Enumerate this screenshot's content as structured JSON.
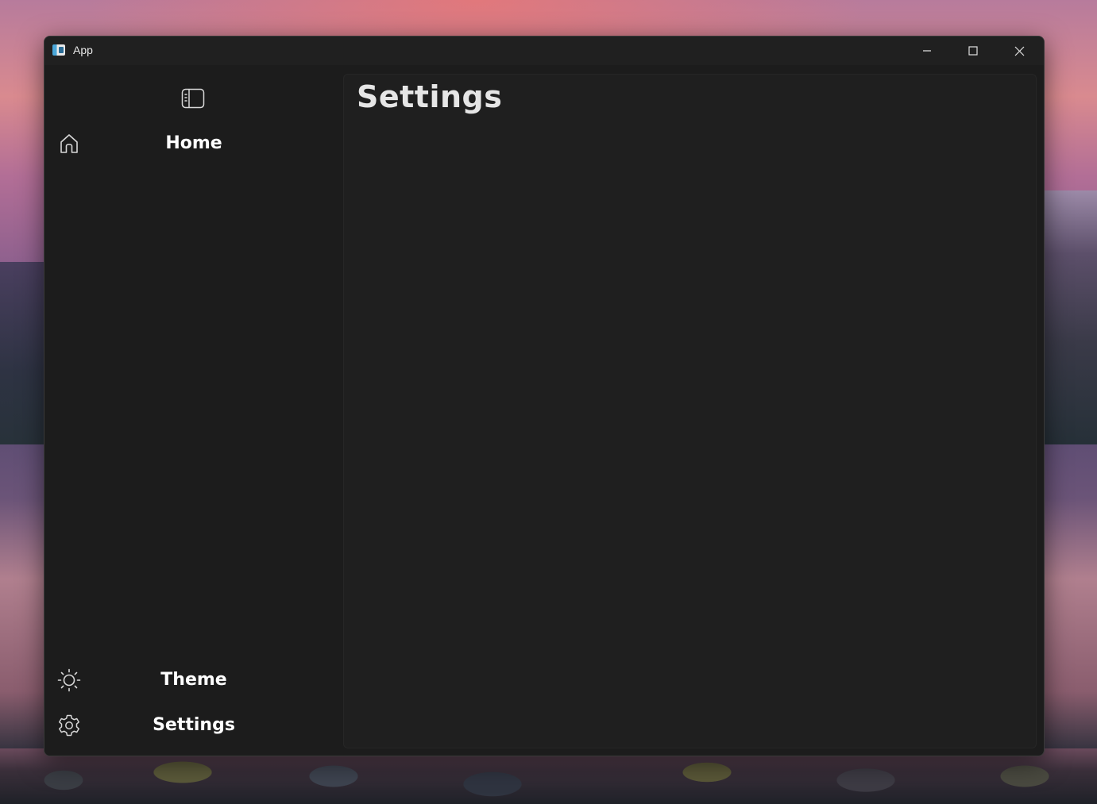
{
  "window": {
    "title": "App",
    "caption_buttons": [
      "minimize-icon",
      "maximize-icon",
      "close-icon"
    ]
  },
  "sidebar": {
    "toggle_icon": "sidebar-toggle-icon",
    "items": [
      {
        "label": "Home",
        "icon": "home-icon"
      }
    ],
    "footer_items": [
      {
        "label": "Theme",
        "icon": "sun-icon"
      },
      {
        "label": "Settings",
        "icon": "gear-icon"
      }
    ]
  },
  "main": {
    "title": "Settings"
  },
  "colors": {
    "window_bg": "#1c1c1c",
    "titlebar_bg": "#202020",
    "content_bg": "#1f1f1f",
    "text": "#ffffff",
    "title_text": "#e6e6e6"
  }
}
